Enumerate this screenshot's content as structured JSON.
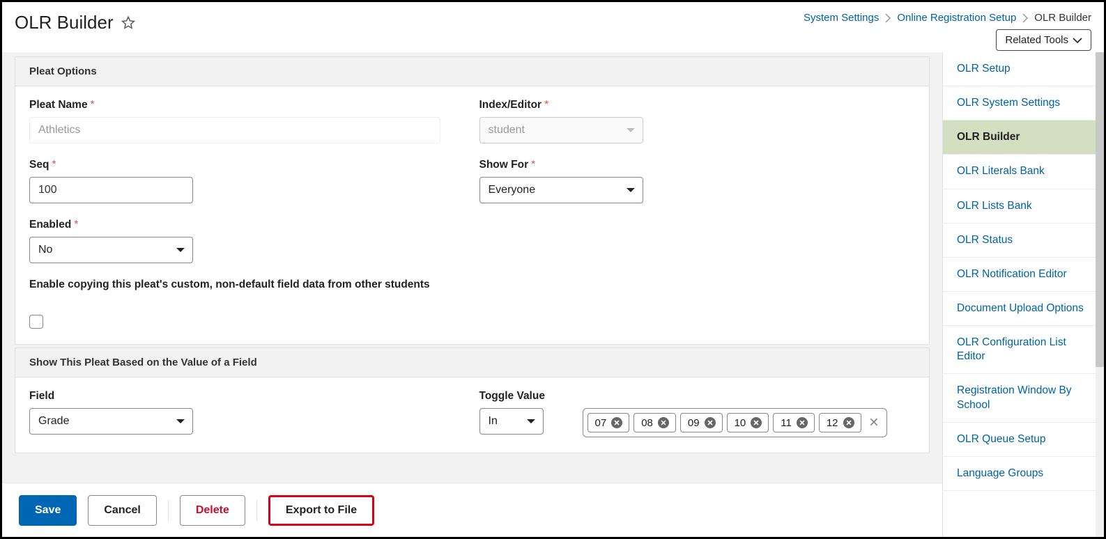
{
  "header": {
    "title": "OLR Builder",
    "related_tools": "Related Tools"
  },
  "breadcrumb": {
    "item1": "System Settings",
    "item2": "Online Registration Setup",
    "current": "OLR Builder"
  },
  "panel1": {
    "title": "Pleat Options",
    "pleat_name_label": "Pleat Name",
    "pleat_name_value": "Athletics",
    "index_editor_label": "Index/Editor",
    "index_editor_value": "student",
    "seq_label": "Seq",
    "seq_value": "100",
    "show_for_label": "Show For",
    "show_for_value": "Everyone",
    "enabled_label": "Enabled",
    "enabled_value": "No",
    "copy_checkbox_label": "Enable copying this pleat's custom, non-default field data from other students"
  },
  "panel2": {
    "title": "Show This Pleat Based on the Value of a Field",
    "field_label": "Field",
    "field_value": "Grade",
    "toggle_value_label": "Toggle Value",
    "toggle_op": "In",
    "tags": [
      "07",
      "08",
      "09",
      "10",
      "11",
      "12"
    ]
  },
  "actions": {
    "save": "Save",
    "cancel": "Cancel",
    "delete": "Delete",
    "export": "Export to File"
  },
  "sidenav": [
    {
      "label": "OLR Setup",
      "active": false
    },
    {
      "label": "OLR System Settings",
      "active": false
    },
    {
      "label": "OLR Builder",
      "active": true
    },
    {
      "label": "OLR Literals Bank",
      "active": false
    },
    {
      "label": "OLR Lists Bank",
      "active": false
    },
    {
      "label": "OLR Status",
      "active": false
    },
    {
      "label": "OLR Notification Editor",
      "active": false
    },
    {
      "label": "Document Upload Options",
      "active": false
    },
    {
      "label": "OLR Configuration List Editor",
      "active": false
    },
    {
      "label": "Registration Window By School",
      "active": false
    },
    {
      "label": "OLR Queue Setup",
      "active": false
    },
    {
      "label": "Language Groups",
      "active": false
    }
  ]
}
